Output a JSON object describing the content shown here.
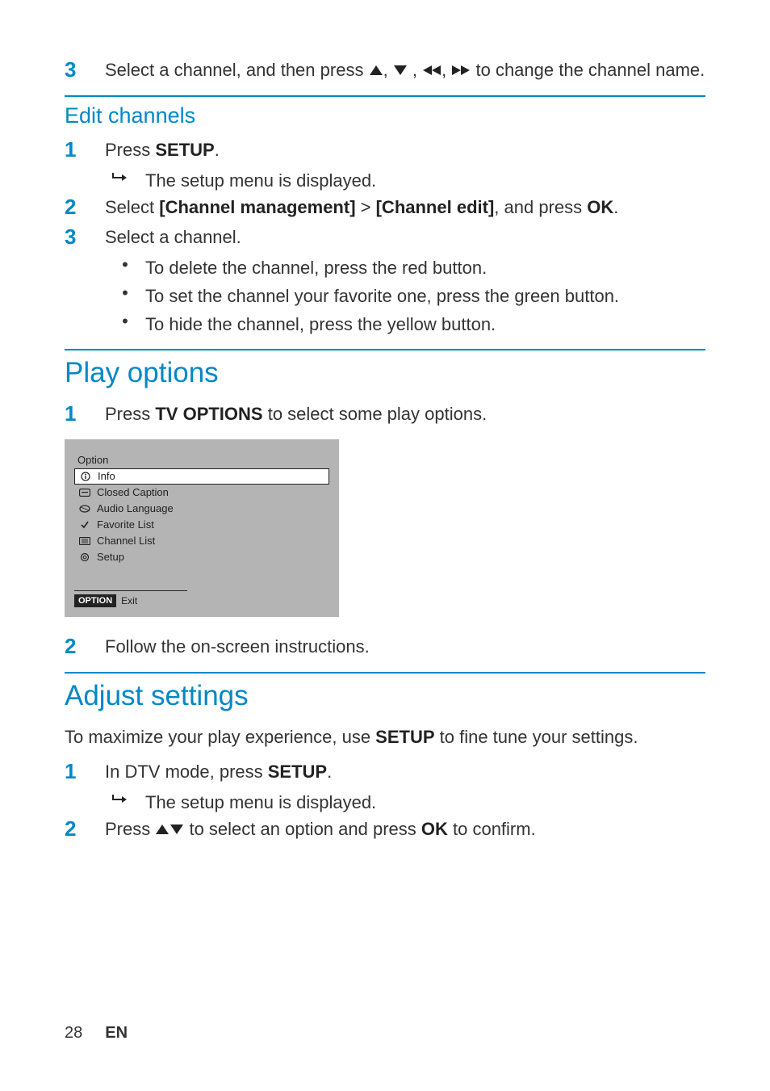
{
  "top_step": {
    "num": "3",
    "pre": "Select a channel, and then press ",
    "mid1": ", ",
    "mid2": " , ",
    "mid3": ", ",
    "post": " to change the channel name."
  },
  "edit": {
    "heading": "Edit channels",
    "s1": {
      "num": "1",
      "pre": "Press ",
      "bold": "SETUP",
      "post": "."
    },
    "s1_sub": "The setup menu is displayed.",
    "s2": {
      "num": "2",
      "pre": "Select ",
      "b1": "[Channel management]",
      "gt": " > ",
      "b2": "[Channel edit]",
      "mid": ", and press ",
      "b3": "OK",
      "post": "."
    },
    "s3": {
      "num": "3",
      "text": "Select a channel."
    },
    "b1": "To delete the channel, press the red button.",
    "b2": "To set the channel your favorite one, press the green button.",
    "b3": "To hide the channel, press the yellow button."
  },
  "play": {
    "heading": "Play options",
    "s1": {
      "num": "1",
      "pre": "Press ",
      "bold": "TV OPTIONS",
      "post": " to select some play options."
    },
    "osd": {
      "title": "Option",
      "items": [
        "Info",
        "Closed Caption",
        "Audio Language",
        "Favorite List",
        "Channel List",
        "Setup"
      ],
      "badge": "OPTION",
      "exit": "Exit"
    },
    "s2": {
      "num": "2",
      "text": "Follow the on-screen instructions."
    }
  },
  "adjust": {
    "heading": "Adjust settings",
    "intro_pre": "To maximize your play experience, use ",
    "intro_bold": "SETUP",
    "intro_post": " to fine tune your settings.",
    "s1": {
      "num": "1",
      "pre": "In DTV mode, press ",
      "bold": "SETUP",
      "post": "."
    },
    "s1_sub": "The setup menu is displayed.",
    "s2": {
      "num": "2",
      "pre": "Press ",
      "mid": " to select an option and press ",
      "bold": "OK",
      "post": " to confirm."
    }
  },
  "footer": {
    "page": "28",
    "lang": "EN"
  }
}
